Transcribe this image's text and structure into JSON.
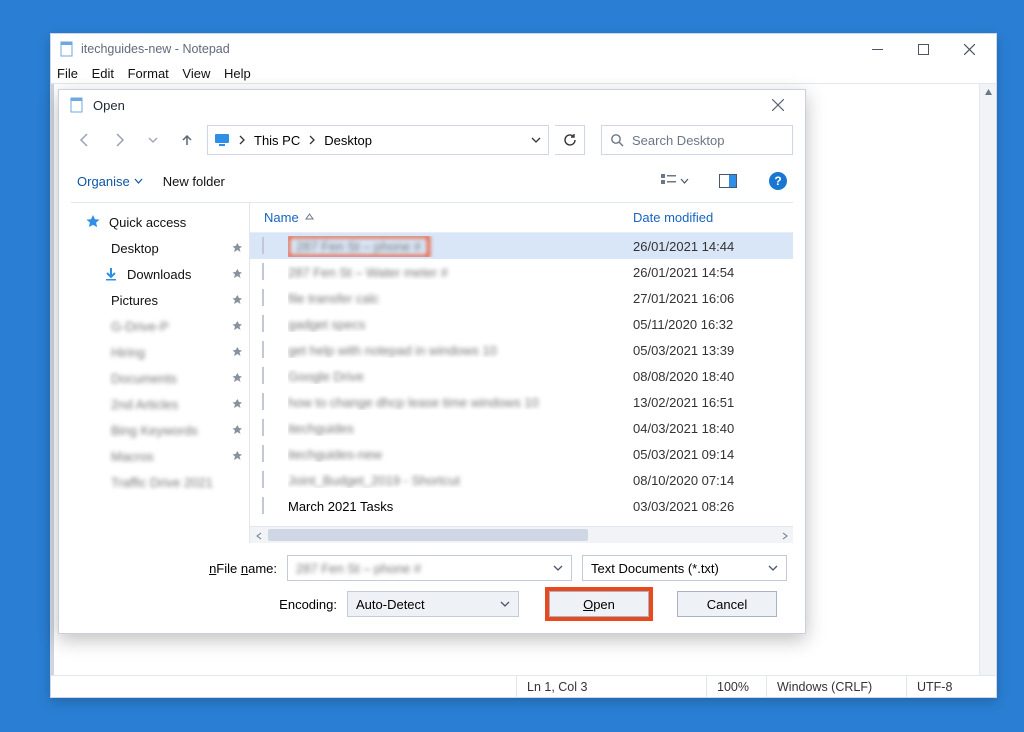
{
  "notepad": {
    "title": "itechguides-new - Notepad",
    "menu": {
      "file": "File",
      "edit": "Edit",
      "format": "Format",
      "view": "View",
      "help": "Help"
    },
    "status": {
      "pos": "Ln 1, Col 3",
      "zoom": "100%",
      "eol": "Windows (CRLF)",
      "enc": "UTF-8"
    }
  },
  "dialog": {
    "title": "Open",
    "path": {
      "root_icon": "monitor-icon",
      "seg1": "This PC",
      "seg2": "Desktop"
    },
    "search": {
      "placeholder": "Search Desktop"
    },
    "toolbar": {
      "organise": "Organise",
      "newfolder": "New folder"
    },
    "columns": {
      "name": "Name",
      "date": "Date modified"
    },
    "sidebar": {
      "quick": "Quick access",
      "items": [
        {
          "label": "Desktop",
          "pinned": true,
          "icon": "desk",
          "blurred": false
        },
        {
          "label": "Downloads",
          "pinned": true,
          "icon": "down",
          "blurred": false
        },
        {
          "label": "Pictures",
          "pinned": true,
          "icon": "pic",
          "blurred": false
        },
        {
          "label": "G-Drive-P",
          "pinned": true,
          "icon": "fold",
          "blurred": true
        },
        {
          "label": "Hiring",
          "pinned": true,
          "icon": "fold",
          "blurred": true
        },
        {
          "label": "Documents",
          "pinned": true,
          "icon": "fold",
          "blurred": true
        },
        {
          "label": "2nd Articles",
          "pinned": true,
          "icon": "fold",
          "blurred": true
        },
        {
          "label": "Bing Keywords",
          "pinned": true,
          "icon": "fold",
          "blurred": true
        },
        {
          "label": "Macros",
          "pinned": true,
          "icon": "fold",
          "blurred": true
        },
        {
          "label": "Traffic Drive 2021",
          "pinned": false,
          "icon": "fold",
          "blurred": true
        }
      ]
    },
    "files": [
      {
        "name": "287 Fen St – phone #",
        "date": "26/01/2021 14:44",
        "blurred": true,
        "selected": true,
        "highlighted": true
      },
      {
        "name": "287 Fen St – Water meter #",
        "date": "26/01/2021 14:54",
        "blurred": true,
        "selected": false,
        "highlighted": false
      },
      {
        "name": "file transfer calc",
        "date": "27/01/2021 16:06",
        "blurred": true,
        "selected": false,
        "highlighted": false
      },
      {
        "name": "gadget specs",
        "date": "05/11/2020 16:32",
        "blurred": true,
        "selected": false,
        "highlighted": false
      },
      {
        "name": "get help with notepad in windows 10",
        "date": "05/03/2021 13:39",
        "blurred": true,
        "selected": false,
        "highlighted": false
      },
      {
        "name": "Google Drive",
        "date": "08/08/2020 18:40",
        "blurred": true,
        "selected": false,
        "highlighted": false
      },
      {
        "name": "how to change dhcp lease time windows 10",
        "date": "13/02/2021 16:51",
        "blurred": true,
        "selected": false,
        "highlighted": false
      },
      {
        "name": "itechguides",
        "date": "04/03/2021 18:40",
        "blurred": true,
        "selected": false,
        "highlighted": false
      },
      {
        "name": "itechguides-new",
        "date": "05/03/2021 09:14",
        "blurred": true,
        "selected": false,
        "highlighted": false
      },
      {
        "name": "Joint_Budget_2019 - Shortcut",
        "date": "08/10/2020 07:14",
        "blurred": true,
        "selected": false,
        "highlighted": false
      },
      {
        "name": "March 2021 Tasks",
        "date": "03/03/2021 08:26",
        "blurred": false,
        "selected": false,
        "highlighted": false
      }
    ],
    "bottom": {
      "file_label": "File name:",
      "file_value": "287 Fen St – phone #",
      "file_value_blurred": true,
      "filter": "Text Documents (*.txt)",
      "enc_label": "Encoding:",
      "enc_value": "Auto-Detect",
      "open": "Open",
      "cancel": "Cancel"
    }
  }
}
